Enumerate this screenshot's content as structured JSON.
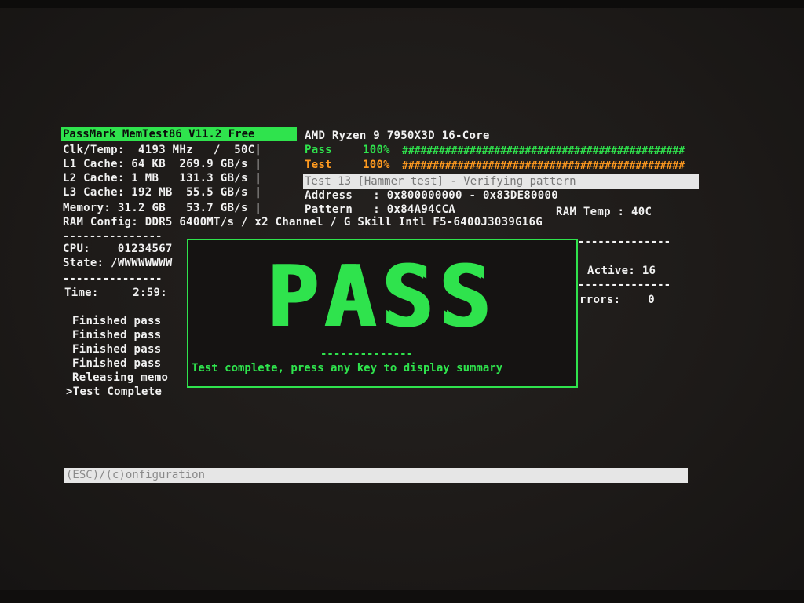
{
  "header": {
    "title": "PassMark MemTest86 V11.2 Free",
    "cpu_name": "AMD Ryzen 9 7950X3D 16-Core"
  },
  "system": {
    "clk_temp": "Clk/Temp:  4193 MHz   /  50C|",
    "l1": "L1 Cache: 64 KB  269.9 GB/s |",
    "l2": "L2 Cache: 1 MB   131.3 GB/s |",
    "l3": "L3 Cache: 192 MB  55.5 GB/s |",
    "memory": "Memory: 31.2 GB   53.7 GB/s |",
    "ram_config": "RAM Config: DDR5 6400MT/s / x2 Channel / G Skill Intl F5-6400J3039G16G"
  },
  "progress": {
    "pass_label": "Pass",
    "pass_pct": "100%",
    "pass_hashes": "##############################################",
    "test_label": "Test",
    "test_pct": "100%",
    "test_hashes": "##############################################",
    "current_test": "Test 13 [Hammer test] - Verifying pattern",
    "address": "Address   : 0x800000000 - 0x83DE80000",
    "pattern": "Pattern   : 0x84A94CCA",
    "ram_temp": "RAM Temp : 40C"
  },
  "status_panel": {
    "separator_left": "---------------",
    "separator_right": "--------------",
    "cpu": "CPU:    01234567",
    "state": "State: /WWWWWWWW",
    "active": "Active: 16",
    "time": "Time:     2:59:",
    "errors": "rrors:    0"
  },
  "log": {
    "lines": [
      "Finished pass",
      "Finished pass",
      "Finished pass",
      "Finished pass",
      "Releasing memo",
      ">Test Complete"
    ]
  },
  "pass_dialog": {
    "big_text": "PASS",
    "divider": "--------------",
    "message": "Test complete, press any key to display summary"
  },
  "footer": {
    "hint": "(ESC)/(c)onfiguration"
  },
  "colors": {
    "accent_green": "#2fe34d",
    "accent_orange": "#ff9a1f",
    "background": "#1d1a18"
  }
}
